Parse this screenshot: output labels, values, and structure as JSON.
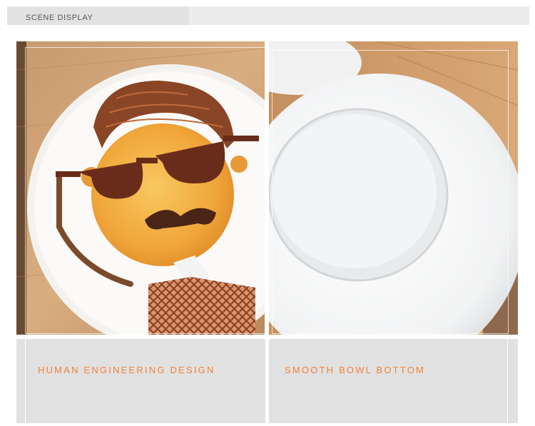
{
  "header": {
    "title": "SCENE DISPLAY"
  },
  "panels": [
    {
      "caption": "HUMAN ENGINEERING DESIGN"
    },
    {
      "caption": "SMOOTH BOWL BOTTOM"
    }
  ],
  "colors": {
    "accent": "#f0823a",
    "caption_bg": "#e1e1e1",
    "header_bg": "#ececec"
  }
}
